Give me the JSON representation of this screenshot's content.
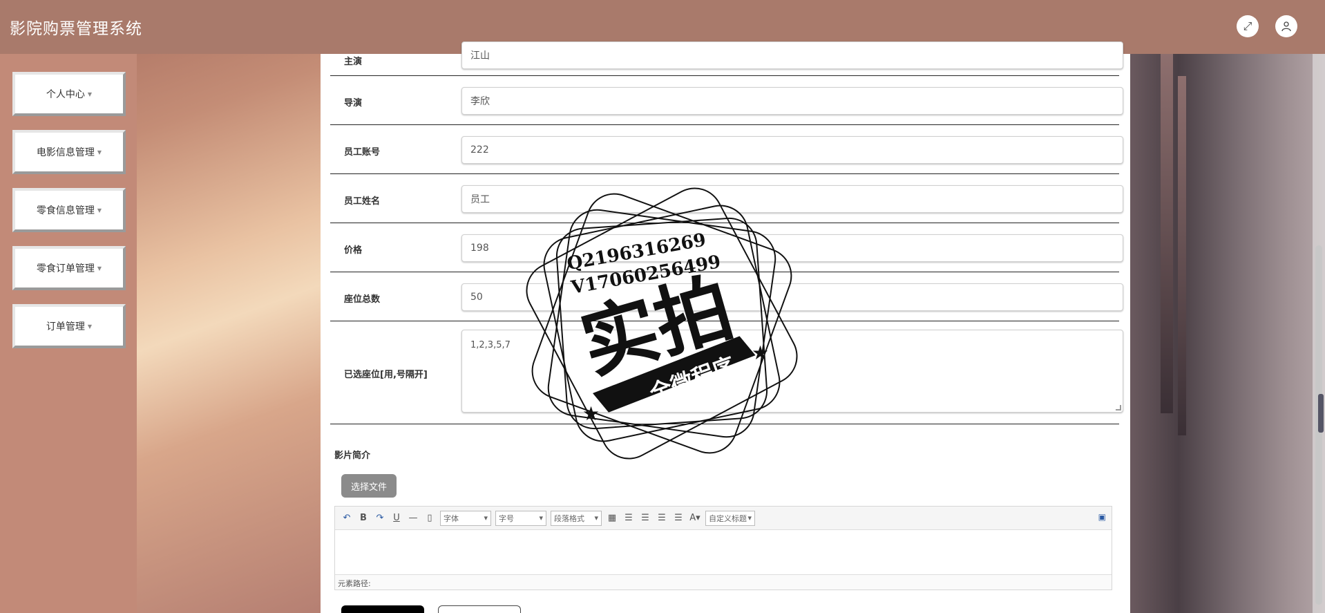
{
  "header": {
    "title": "影院购票管理系统",
    "fullscreen_icon": "expand-icon",
    "user_icon": "user-icon"
  },
  "sidebar": {
    "items": [
      {
        "label": "个人中心"
      },
      {
        "label": "电影信息管理"
      },
      {
        "label": "零食信息管理"
      },
      {
        "label": "零食订单管理"
      },
      {
        "label": "订单管理"
      }
    ]
  },
  "form": {
    "rows": [
      {
        "label": "主演",
        "value": "江山"
      },
      {
        "label": "导演",
        "value": "李欣"
      },
      {
        "label": "员工账号",
        "value": "222"
      },
      {
        "label": "员工姓名",
        "value": "员工"
      },
      {
        "label": "价格",
        "value": "198"
      },
      {
        "label": "座位总数",
        "value": "50"
      }
    ],
    "seats": {
      "label": "已选座位[用,号隔开]",
      "value": "1,2,3,5,7"
    },
    "intro": {
      "label": "影片简介",
      "file_button": "选择文件",
      "toolbar": {
        "font": "字体",
        "size": "字号",
        "paragraph": "段落格式",
        "custom_title": "自定义标题"
      },
      "path_label": "元素路径:"
    }
  },
  "watermark": {
    "line1": "Q2196316269",
    "line2": "V17060256499",
    "big": "实拍",
    "banner": "全微程序"
  }
}
